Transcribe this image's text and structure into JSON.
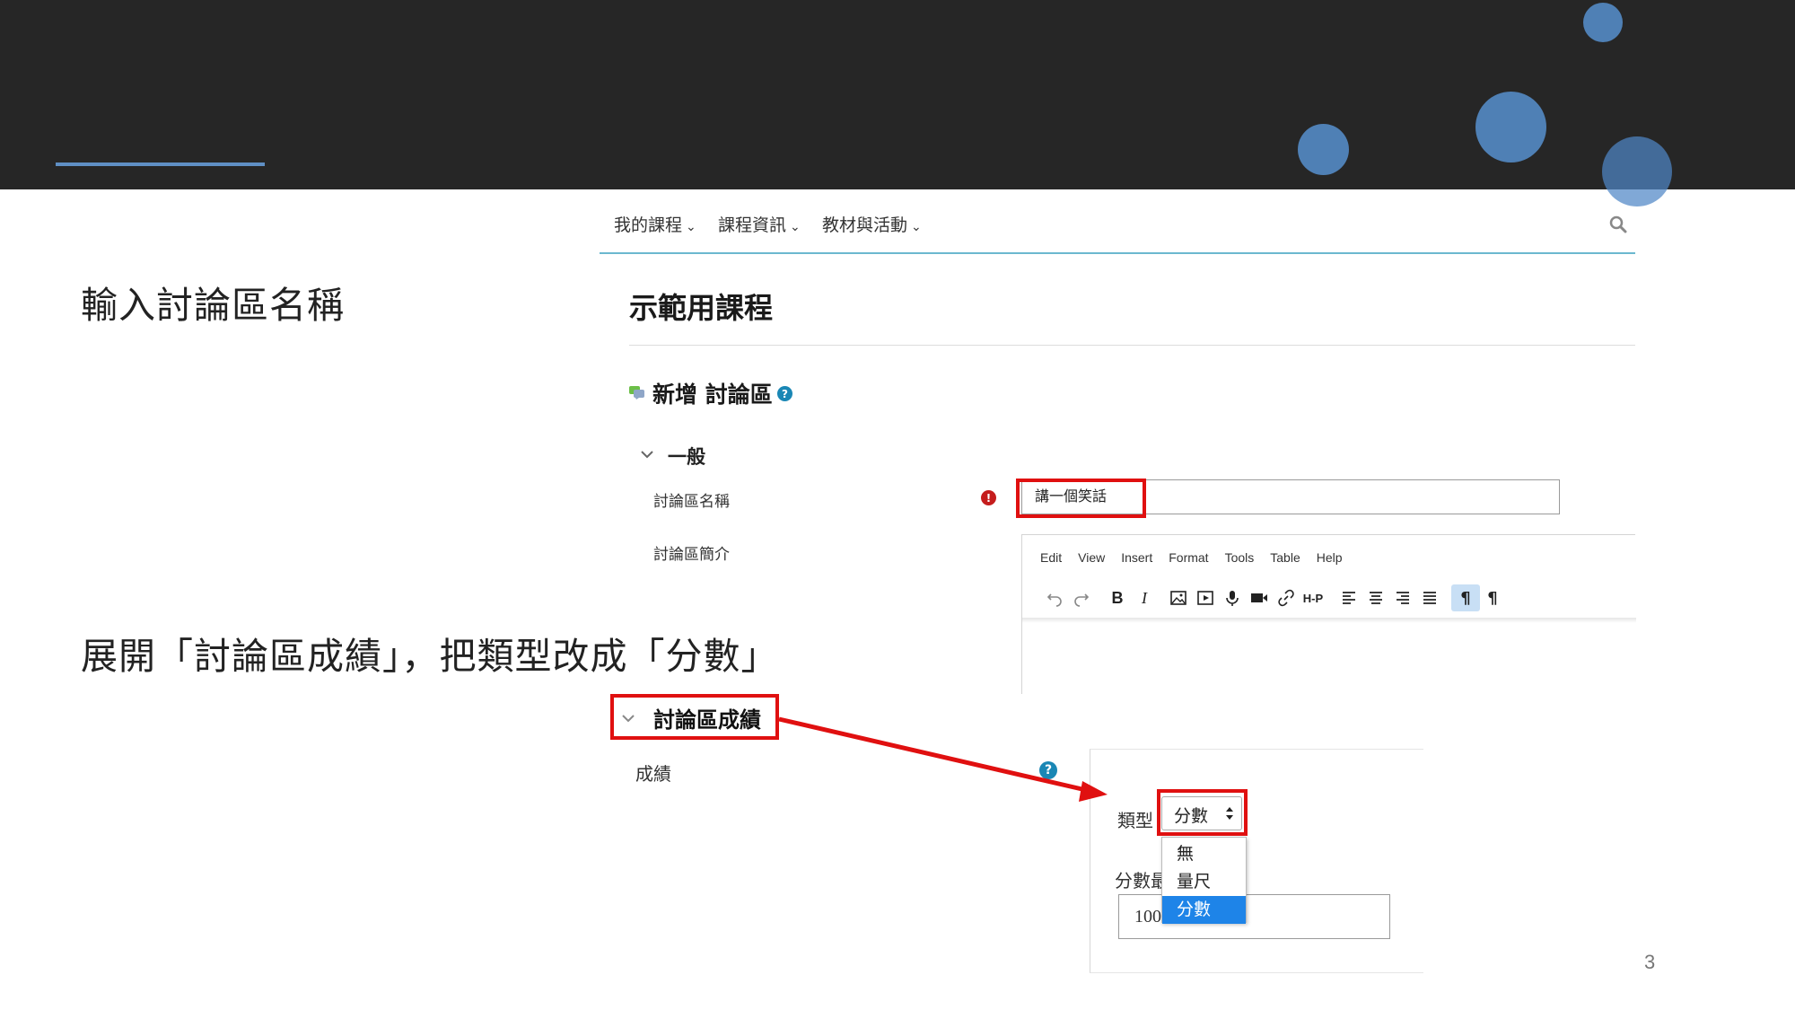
{
  "slide": {
    "instruction_1": "輸入討論區名稱",
    "instruction_2": "展開「討論區成績」，把類型改成「分數」",
    "page_number": "3",
    "colors": {
      "band": "#262626",
      "accent": "#5f8fc4",
      "highlight": "#e01010"
    }
  },
  "nav": {
    "items": [
      {
        "label": "我的課程",
        "icon": "chevron-down-icon"
      },
      {
        "label": "課程資訊",
        "icon": "chevron-down-icon"
      },
      {
        "label": "教材與活動",
        "icon": "chevron-down-icon"
      }
    ],
    "search_icon": "search-icon"
  },
  "course": {
    "title": "示範用課程",
    "page_heading": "新增 討論區"
  },
  "general_section": {
    "title": "一般",
    "forum_name_label": "討論區名稱",
    "forum_name_value": "講一個笑話",
    "forum_intro_label": "討論區簡介"
  },
  "editor": {
    "menu": [
      "Edit",
      "View",
      "Insert",
      "Format",
      "Tools",
      "Table",
      "Help"
    ],
    "toolbar_icons": [
      "undo-icon",
      "redo-icon",
      "bold-icon",
      "italic-icon",
      "image-icon",
      "media-icon",
      "record-audio-icon",
      "record-video-icon",
      "link-icon",
      "h5p-icon",
      "align-left-icon",
      "align-center-icon",
      "align-right-icon",
      "align-justify-icon",
      "ltr-icon",
      "rtl-icon"
    ],
    "bold_label": "B",
    "italic_label": "I",
    "h5p_label": "H-P",
    "ltr_label": "¶",
    "rtl_label": "¶"
  },
  "grade_section": {
    "title": "討論區成績",
    "grade_label": "成績",
    "type_label": "類型",
    "type_selected": "分數",
    "type_options": [
      "無",
      "量尺",
      "分數"
    ],
    "max_grade_label": "分數最",
    "max_grade_value": "100"
  }
}
